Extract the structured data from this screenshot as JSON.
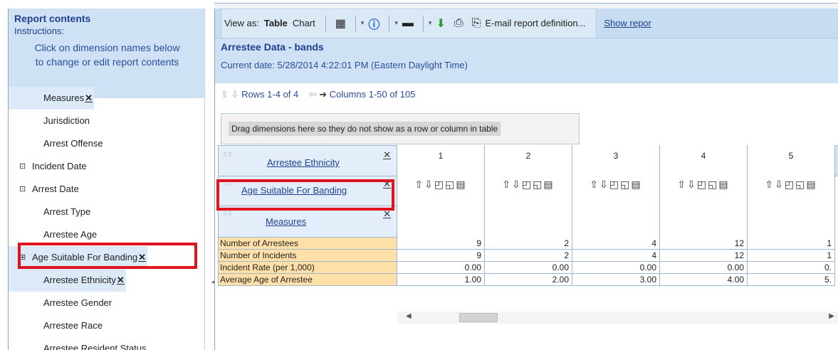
{
  "left_panel": {
    "title": "Report contents",
    "instructions_label": "Instructions:",
    "help_line1": "Click on dimension names below",
    "help_line2": "to change or edit report contents",
    "dimensions": [
      {
        "label": "Measures",
        "removable": true,
        "tree": ""
      },
      {
        "label": "Jurisdiction",
        "removable": false,
        "tree": ""
      },
      {
        "label": "Arrest Offense",
        "removable": false,
        "tree": ""
      },
      {
        "label": "Incident Date",
        "removable": false,
        "tree": "⊡"
      },
      {
        "label": "Arrest Date",
        "removable": false,
        "tree": "⊡"
      },
      {
        "label": "Arrest Type",
        "removable": false,
        "tree": ""
      },
      {
        "label": "Arrestee Age",
        "removable": false,
        "tree": ""
      },
      {
        "label": "Age Suitable For Banding",
        "removable": true,
        "tree": "⊞"
      },
      {
        "label": "Arrestee Ethnicity",
        "removable": true,
        "tree": ""
      },
      {
        "label": "Arrestee Gender",
        "removable": false,
        "tree": ""
      },
      {
        "label": "Arrestee Race",
        "removable": false,
        "tree": ""
      },
      {
        "label": "Arrestee Resident Status",
        "removable": false,
        "tree": ""
      }
    ]
  },
  "toolbar": {
    "view_as_label": "View as:",
    "table_label": "Table",
    "chart_label": "Chart",
    "email_label": "E-mail report definition...",
    "show_report_label": "Show repor"
  },
  "report": {
    "title": "Arrestee Data - bands",
    "current_date": "Current date: 5/28/2014 4:22:01 PM (Eastern Daylight Time)",
    "rows_text": "Rows 1-4 of 4",
    "columns_text": "Columns 1-50 of 105",
    "drag_zone_text": "Drag dimensions here so they do not show as a row or column in table"
  },
  "grid": {
    "header_dims": [
      "Arrestee Ethnicity",
      "Age Suitable For Banding",
      "Measures"
    ],
    "columns": [
      "1",
      "2",
      "3",
      "4",
      "5"
    ],
    "col_icons": "⇧⇩◰◱▤",
    "rows": [
      {
        "label": "Number of Arrestees",
        "values": [
          "9",
          "2",
          "4",
          "12",
          "1"
        ]
      },
      {
        "label": "Number of Incidents",
        "values": [
          "9",
          "2",
          "4",
          "12",
          "1"
        ]
      },
      {
        "label": "Incident Rate (per 1,000)",
        "values": [
          "0.00",
          "0.00",
          "0.00",
          "0.00",
          "0."
        ]
      },
      {
        "label": "Average Age of Arrestee",
        "values": [
          "1.00",
          "2.00",
          "3.00",
          "4.00",
          "5."
        ]
      }
    ]
  },
  "colors": {
    "highlight_red": "#e0141e",
    "header_blue": "#cfe1f4",
    "row_label_orange": "#ffe0a8",
    "title_blue": "#1f3f8f"
  }
}
